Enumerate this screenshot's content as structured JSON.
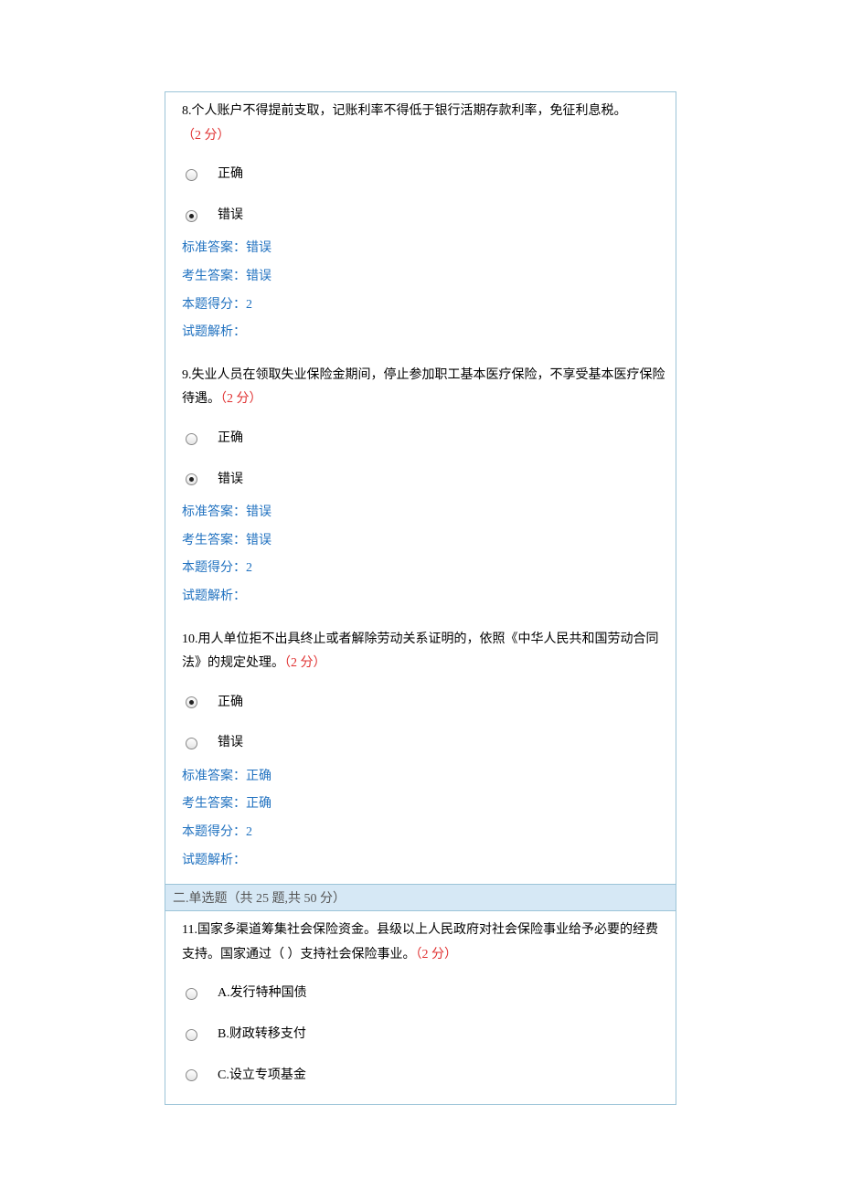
{
  "q8": {
    "number": "8.",
    "text": "个人账户不得提前支取，记账利率不得低于银行活期存款利率，免征利息税。",
    "points": "（2 分）",
    "opt_true": "正确",
    "opt_false": "错误",
    "selected": "false",
    "std_label": "标准答案：",
    "std_val": "错误",
    "user_label": "考生答案：",
    "user_val": "错误",
    "score_label": "本题得分：",
    "score_val": "2",
    "analysis_label": "试题解析："
  },
  "q9": {
    "number": "9.",
    "text": "失业人员在领取失业保险金期间，停止参加职工基本医疗保险，不享受基本医疗保险待遇。",
    "points": "（2 分）",
    "opt_true": "正确",
    "opt_false": "错误",
    "selected": "false",
    "std_label": "标准答案：",
    "std_val": "错误",
    "user_label": "考生答案：",
    "user_val": "错误",
    "score_label": "本题得分：",
    "score_val": "2",
    "analysis_label": "试题解析："
  },
  "q10": {
    "number": "10.",
    "text": "用人单位拒不出具终止或者解除劳动关系证明的，依照《中华人民共和国劳动合同法》的规定处理。",
    "points": "（2 分）",
    "opt_true": "正确",
    "opt_false": "错误",
    "selected": "true",
    "std_label": "标准答案：",
    "std_val": "正确",
    "user_label": "考生答案：",
    "user_val": "正确",
    "score_label": "本题得分：",
    "score_val": "2",
    "analysis_label": "试题解析："
  },
  "section2": {
    "title": "二.单选题（共 25 题,共 50 分）"
  },
  "q11": {
    "number": "11.",
    "text": "国家多渠道筹集社会保险资金。县级以上人民政府对社会保险事业给予必要的经费支持。国家通过（ ）支持社会保险事业。",
    "points": "（2 分）",
    "opt_a": "A.发行特种国债",
    "opt_b": "B.财政转移支付",
    "opt_c": "C.设立专项基金"
  }
}
